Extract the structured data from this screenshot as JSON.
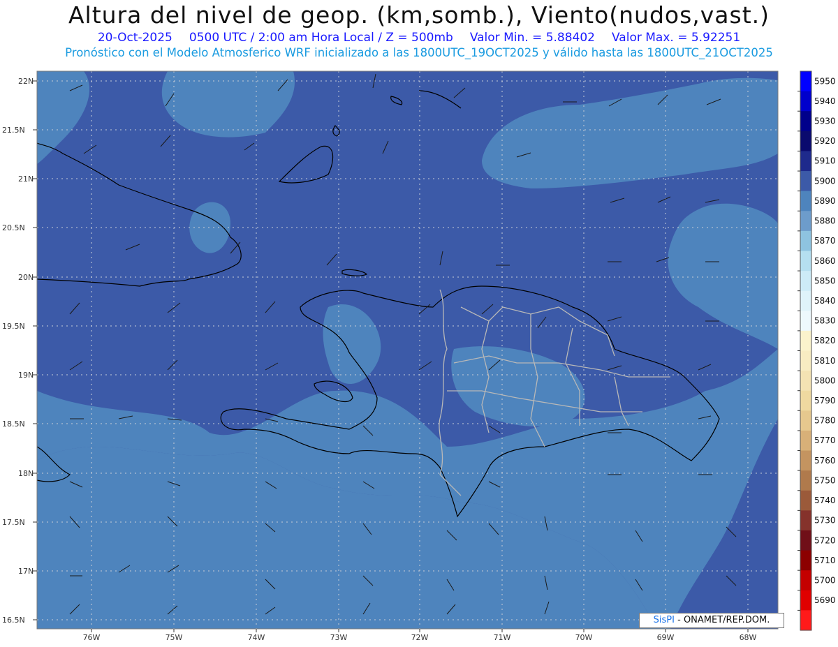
{
  "header": {
    "title": "Altura del nivel de geop. (km,somb.), Viento(nudos,vast.)",
    "date": "20-Oct-2025",
    "time": "0500 UTC / 2:00 am Hora Local / Z = 500mb",
    "min": "Valor Min. = 5.88402",
    "max": "Valor Max. = 5.92251",
    "forecast": "Pronóstico con el Modelo Atmosferico WRF inicializado a las 1800UTC_19OCT2025 y válido hasta las  1800UTC_21OCT2025"
  },
  "axes": {
    "lat_labels": [
      "22N",
      "21.5N",
      "21N",
      "20.5N",
      "20N",
      "19.5N",
      "19N",
      "18.5N",
      "18N",
      "17.5N",
      "17N",
      "16.5N"
    ],
    "lon_labels": [
      "76W",
      "75W",
      "74W",
      "73W",
      "72W",
      "71W",
      "70W",
      "69W",
      "68W"
    ]
  },
  "colorbar": {
    "labels": [
      "5950",
      "5940",
      "5930",
      "5920",
      "5910",
      "5900",
      "5890",
      "5880",
      "5870",
      "5860",
      "5850",
      "5840",
      "5830",
      "5820",
      "5810",
      "5800",
      "5790",
      "5780",
      "5770",
      "5760",
      "5750",
      "5740",
      "5730",
      "5720",
      "5710",
      "5700",
      "5690"
    ],
    "colors": [
      "#0000ff",
      "#0000cc",
      "#00008b",
      "#0a0a6e",
      "#1e2a8c",
      "#3c5aa8",
      "#4e84bd",
      "#6d9ccb",
      "#8ec3e0",
      "#b5dff0",
      "#cdebf7",
      "#dff3fa",
      "#eef9fd",
      "#fbf3cc",
      "#f8ecc2",
      "#f4e3b3",
      "#efd9a0",
      "#e6c88e",
      "#d8b078",
      "#c49460",
      "#b07a4c",
      "#9b5a3a",
      "#85322b",
      "#700f18",
      "#8c0000",
      "#c40000",
      "#e00000",
      "#ff1a1a"
    ]
  },
  "map_colors": {
    "dark_blue": "#3c5aa8",
    "mid_blue": "#4e84bd",
    "light_blue": "#6d9ccb"
  },
  "credit": {
    "brand": "SisPI",
    "text": " - ONAMET/REP.DOM."
  }
}
